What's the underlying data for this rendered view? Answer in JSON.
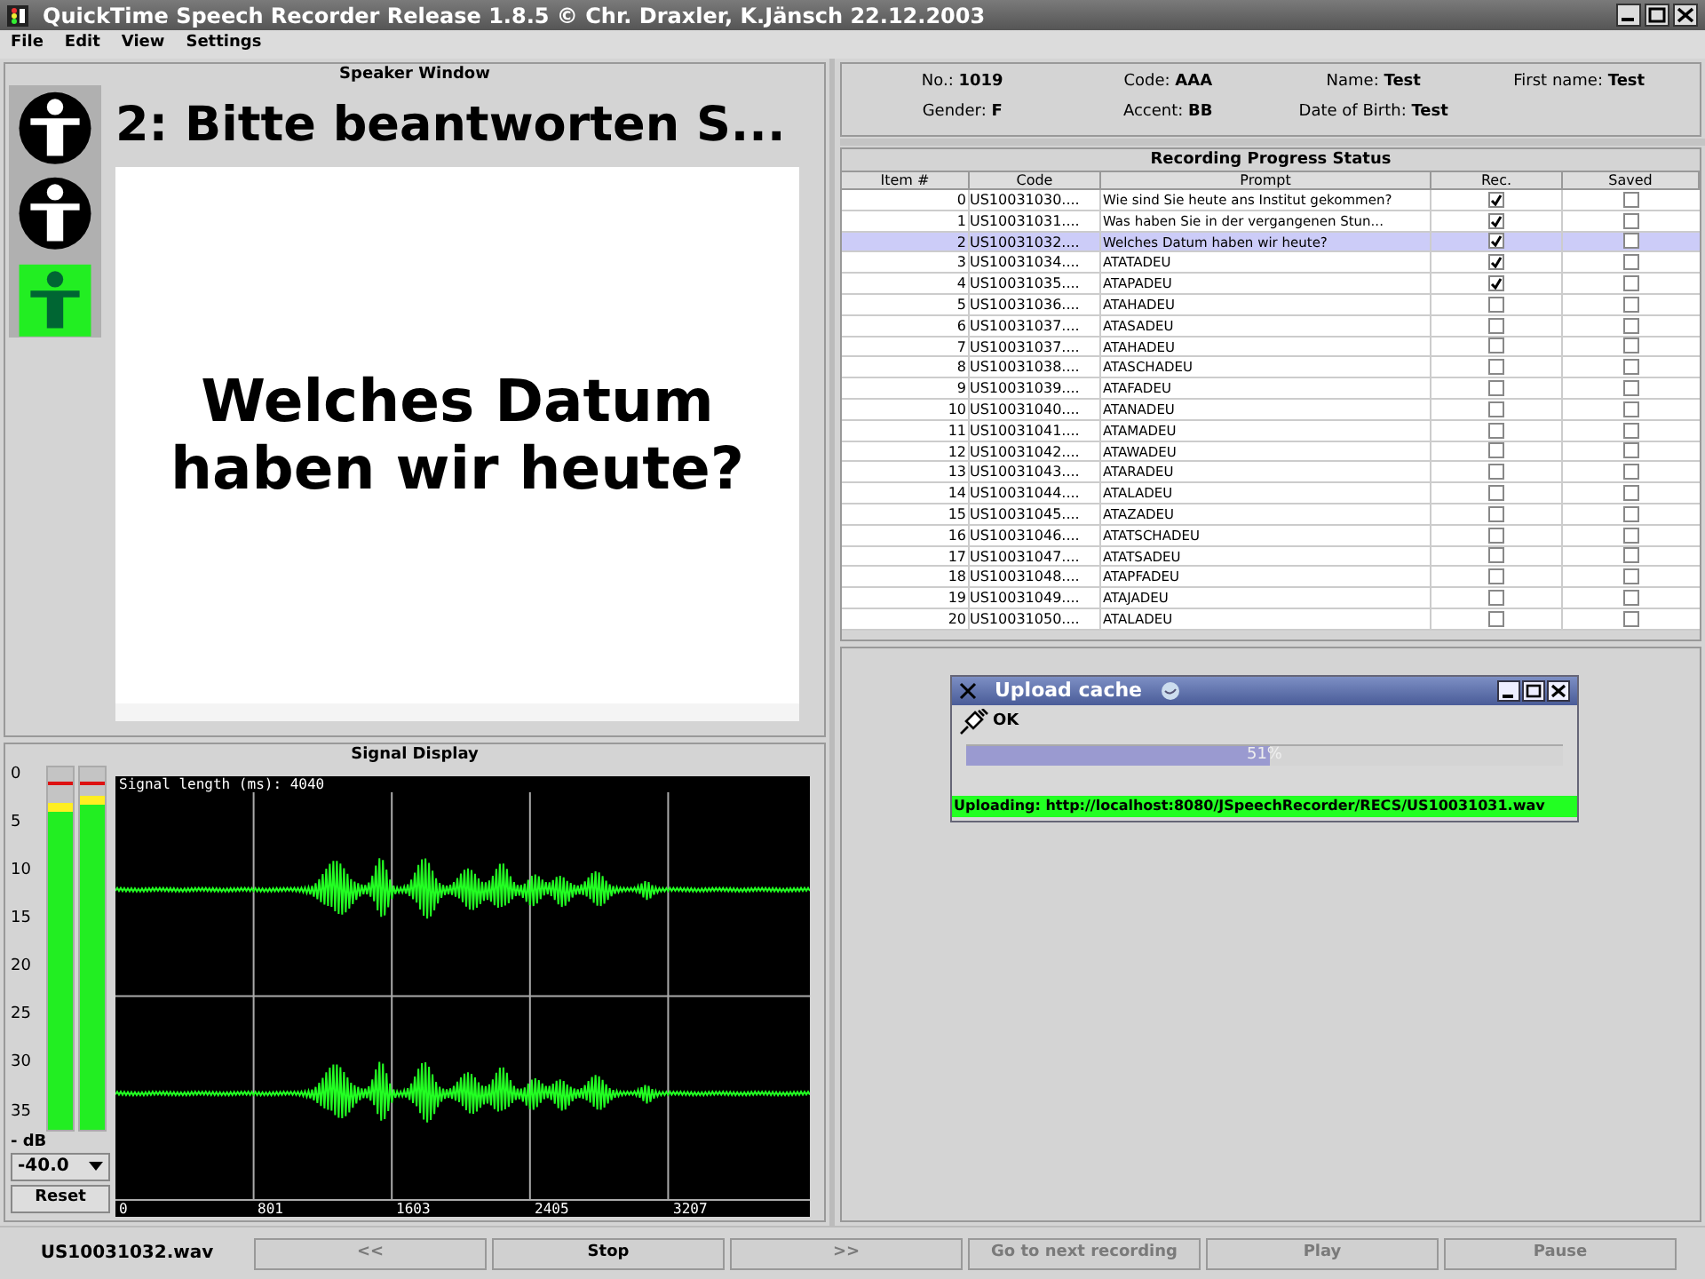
{
  "window": {
    "title": "QuickTime Speech Recorder Release 1.8.5 © Chr. Draxler, K.Jänsch 22.12.2003"
  },
  "menu": [
    "File",
    "Edit",
    "View",
    "Settings"
  ],
  "speaker_window": {
    "title": "Speaker Window",
    "lights": [
      {
        "on": false
      },
      {
        "on": false
      },
      {
        "on": true
      }
    ],
    "instruction": "2: Bitte beantworten S...",
    "prompt": "Welches Datum haben wir heute?"
  },
  "signal_display": {
    "title": "Signal Display",
    "meter_ticks": [
      "0",
      "5",
      "10",
      "15",
      "20",
      "25",
      "30",
      "35"
    ],
    "meter_unit": "- dB",
    "meters": [
      {
        "level": 0.9,
        "peak": true
      },
      {
        "level": 0.92,
        "peak": true
      }
    ],
    "threshold": "-40.0",
    "reset": "Reset",
    "signal_length": "Signal length (ms): 4040",
    "x_ticks": [
      "0",
      "801",
      "1603",
      "2405",
      "3207"
    ]
  },
  "speaker_info": [
    {
      "label": "No.:",
      "value": "1019"
    },
    {
      "label": "Code:",
      "value": "AAA"
    },
    {
      "label": "Name:",
      "value": "Test"
    },
    {
      "label": "First name:",
      "value": "Test"
    },
    {
      "label": "Gender:",
      "value": "F"
    },
    {
      "label": "Accent:",
      "value": "BB"
    },
    {
      "label": "Date of Birth:",
      "value": "Test"
    }
  ],
  "table": {
    "title": "Recording Progress Status",
    "columns": [
      "Item #",
      "Code",
      "Prompt",
      "Rec.",
      "Saved"
    ],
    "rows": [
      {
        "item": "0",
        "code": "US10031030....",
        "prompt": "Wie sind Sie heute ans Institut gekommen?",
        "rec": true,
        "saved": false,
        "selected": false
      },
      {
        "item": "1",
        "code": "US10031031....",
        "prompt": "Was haben Sie in der vergangenen Stun...",
        "rec": true,
        "saved": false,
        "selected": false
      },
      {
        "item": "2",
        "code": "US10031032....",
        "prompt": "Welches Datum haben wir heute?",
        "rec": true,
        "saved": false,
        "selected": true
      },
      {
        "item": "3",
        "code": "US10031034....",
        "prompt": "ATATADEU",
        "rec": true,
        "saved": false,
        "selected": false
      },
      {
        "item": "4",
        "code": "US10031035....",
        "prompt": "ATAPADEU",
        "rec": true,
        "saved": false,
        "selected": false
      },
      {
        "item": "5",
        "code": "US10031036....",
        "prompt": "ATAHADEU",
        "rec": false,
        "saved": false,
        "selected": false
      },
      {
        "item": "6",
        "code": "US10031037....",
        "prompt": "ATASADEU",
        "rec": false,
        "saved": false,
        "selected": false
      },
      {
        "item": "7",
        "code": "US10031037....",
        "prompt": "ATAHADEU",
        "rec": false,
        "saved": false,
        "selected": false
      },
      {
        "item": "8",
        "code": "US10031038....",
        "prompt": "ATASCHADEU",
        "rec": false,
        "saved": false,
        "selected": false
      },
      {
        "item": "9",
        "code": "US10031039....",
        "prompt": "ATAFADEU",
        "rec": false,
        "saved": false,
        "selected": false
      },
      {
        "item": "10",
        "code": "US10031040....",
        "prompt": "ATANADEU",
        "rec": false,
        "saved": false,
        "selected": false
      },
      {
        "item": "11",
        "code": "US10031041....",
        "prompt": "ATAMADEU",
        "rec": false,
        "saved": false,
        "selected": false
      },
      {
        "item": "12",
        "code": "US10031042....",
        "prompt": "ATAWADEU",
        "rec": false,
        "saved": false,
        "selected": false
      },
      {
        "item": "13",
        "code": "US10031043....",
        "prompt": "ATARADEU",
        "rec": false,
        "saved": false,
        "selected": false
      },
      {
        "item": "14",
        "code": "US10031044....",
        "prompt": "ATALADEU",
        "rec": false,
        "saved": false,
        "selected": false
      },
      {
        "item": "15",
        "code": "US10031045....",
        "prompt": "ATAZADEU",
        "rec": false,
        "saved": false,
        "selected": false
      },
      {
        "item": "16",
        "code": "US10031046....",
        "prompt": "ATATSCHADEU",
        "rec": false,
        "saved": false,
        "selected": false
      },
      {
        "item": "17",
        "code": "US10031047....",
        "prompt": "ATATSADEU",
        "rec": false,
        "saved": false,
        "selected": false
      },
      {
        "item": "18",
        "code": "US10031048....",
        "prompt": "ATAPFADEU",
        "rec": false,
        "saved": false,
        "selected": false
      },
      {
        "item": "19",
        "code": "US10031049....",
        "prompt": "ATAJADEU",
        "rec": false,
        "saved": false,
        "selected": false
      },
      {
        "item": "20",
        "code": "US10031050....",
        "prompt": "ATALADEU",
        "rec": false,
        "saved": false,
        "selected": false
      }
    ]
  },
  "upload_dialog": {
    "title": "Upload cache",
    "status": "OK",
    "level": 0.51,
    "percent": "51%",
    "message": "Uploading: http://localhost:8080/JSpeechRecorder/RECS/US10031031.wav"
  },
  "bottom_bar": {
    "file": "US10031032.wav",
    "buttons": [
      {
        "label": "<<",
        "disabled": true
      },
      {
        "label": "Stop",
        "disabled": false
      },
      {
        "label": ">>",
        "disabled": true
      },
      {
        "label": "Go to next recording",
        "disabled": true
      },
      {
        "label": "Play",
        "disabled": true
      },
      {
        "label": "Pause",
        "disabled": true
      }
    ]
  }
}
